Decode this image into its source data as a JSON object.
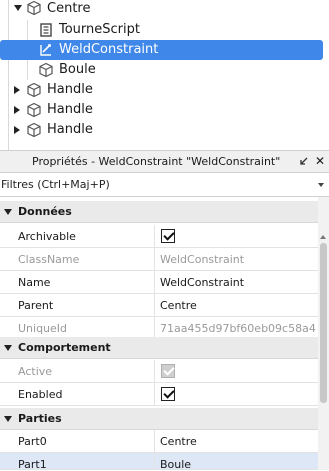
{
  "explorer": {
    "items": [
      {
        "label": "Centre",
        "icon": "part-cube-icon",
        "expander": "expanded"
      },
      {
        "label": "TourneScript",
        "icon": "script-icon",
        "expander": ""
      },
      {
        "label": "WeldConstraint",
        "icon": "weld-constraint-icon",
        "expander": "",
        "selected": true
      },
      {
        "label": "Boule",
        "icon": "part-cube-icon",
        "expander": ""
      },
      {
        "label": "Handle",
        "icon": "part-cube-icon",
        "expander": "collapsed"
      },
      {
        "label": "Handle",
        "icon": "part-cube-icon",
        "expander": "collapsed"
      },
      {
        "label": "Handle",
        "icon": "part-cube-icon",
        "expander": "collapsed"
      }
    ],
    "selection_color": "#3f87e8"
  },
  "properties": {
    "title": "Propriétés - WeldConstraint \"WeldConstraint\"",
    "filter_placeholder": "Filtres (Ctrl+Maj+P)",
    "categories": {
      "donnees": "Données",
      "comportement": "Comportement",
      "parties": "Parties"
    },
    "rows": {
      "archivable": {
        "name": "Archivable",
        "checked": true
      },
      "classname": {
        "name": "ClassName",
        "value": "WeldConstraint"
      },
      "name": {
        "name": "Name",
        "value": "WeldConstraint"
      },
      "parent": {
        "name": "Parent",
        "value": "Centre"
      },
      "uniqueid": {
        "name": "UniqueId",
        "value": "71aa455d97bf60eb09c58a4..."
      },
      "active": {
        "name": "Active",
        "checked": true,
        "disabled": true
      },
      "enabled": {
        "name": "Enabled",
        "checked": true
      },
      "part0": {
        "name": "Part0",
        "value": "Centre"
      },
      "part1": {
        "name": "Part1",
        "value": "Boule"
      }
    }
  }
}
